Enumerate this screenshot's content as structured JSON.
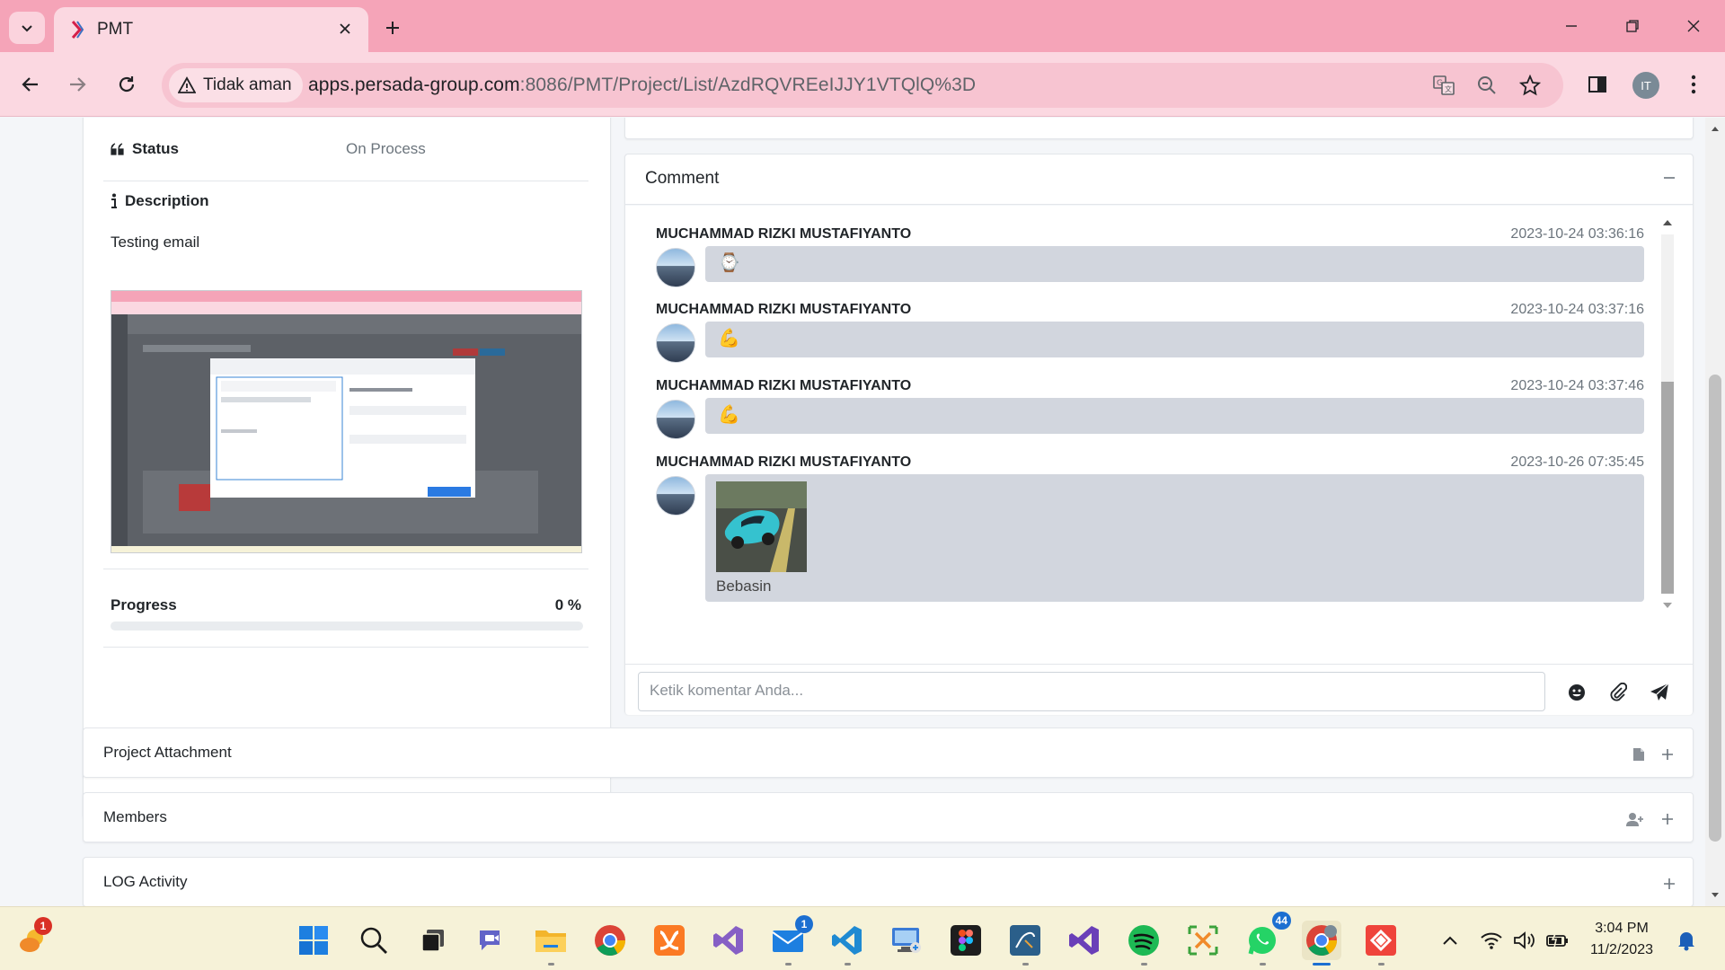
{
  "browser": {
    "tab_title": "PMT",
    "security_label": "Tidak aman",
    "url_host": "apps.persada-group.com",
    "url_rest": ":8086/PMT/Project/List/AzdRQVREeIJJY1VTQlQ%3D",
    "profile_initials": "IT"
  },
  "project": {
    "status_label": "Status",
    "status_value": "On Process",
    "description_label": "Description",
    "description_text": "Testing email",
    "progress_label": "Progress",
    "progress_value": "0 %",
    "progress_fraction": 0
  },
  "comment": {
    "title": "Comment",
    "input_placeholder": "Ketik komentar Anda...",
    "messages": [
      {
        "author": "MUCHAMMAD RIZKI MUSTAFIYANTO",
        "time": "2023-10-24 03:36:16",
        "emoji": "⌚"
      },
      {
        "author": "MUCHAMMAD RIZKI MUSTAFIYANTO",
        "time": "2023-10-24 03:37:16",
        "emoji": "💪"
      },
      {
        "author": "MUCHAMMAD RIZKI MUSTAFIYANTO",
        "time": "2023-10-24 03:37:46",
        "emoji": "💪"
      },
      {
        "author": "MUCHAMMAD RIZKI MUSTAFIYANTO",
        "time": "2023-10-26 07:35:45",
        "caption": "Bebasin"
      }
    ]
  },
  "sections": {
    "attachment": "Project Attachment",
    "members": "Members",
    "log": "LOG Activity"
  },
  "taskbar": {
    "time": "3:04 PM",
    "date": "11/2/2023",
    "weather_badge": "1",
    "mail_badge": "1",
    "whatsapp_badge": "44"
  },
  "colors": {
    "chrome_tab_bar": "#f5a4b8",
    "chrome_toolbar": "#fbd8e1",
    "bubble": "#d2d6de",
    "primary": "#007bff",
    "taskbar": "#f6f2d8"
  }
}
